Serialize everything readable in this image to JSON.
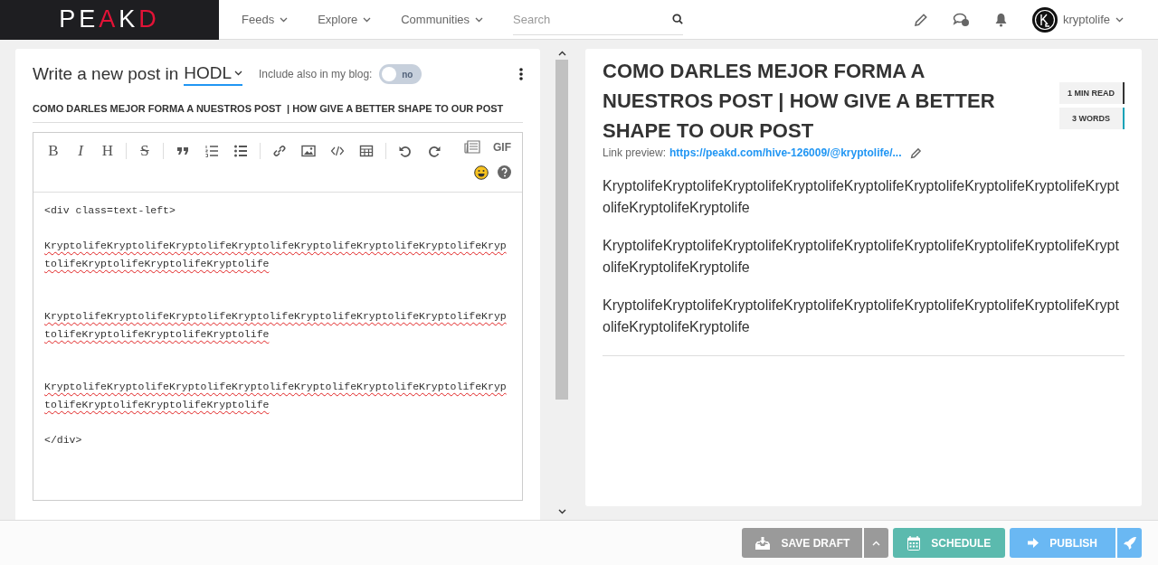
{
  "header": {
    "logo": {
      "letters": [
        {
          "text": "PE",
          "color": "#ffffff"
        },
        {
          "text": "A",
          "color": "#e31337"
        },
        {
          "text": "K",
          "color": "#ffffff"
        },
        {
          "text": "D",
          "color": "#e31337"
        }
      ]
    },
    "nav": [
      {
        "label": "Feeds"
      },
      {
        "label": "Explore"
      },
      {
        "label": "Communities"
      }
    ],
    "search": {
      "placeholder": "Search"
    },
    "user": {
      "name": "kryptolife"
    }
  },
  "editor": {
    "heading": "Write a new post in",
    "community": "HODL",
    "include_label": "Include also in my blog:",
    "include_toggle": {
      "on": false,
      "label": "no"
    },
    "title": "COMO DARLES MEJOR FORMA A NUESTROS POST  | HOW GIVE A BETTER SHAPE TO OUR POST",
    "toolbar": [
      {
        "kind": "bold",
        "label": "B"
      },
      {
        "kind": "italic",
        "label": "I"
      },
      {
        "kind": "heading",
        "label": "H"
      },
      {
        "kind": "sep"
      },
      {
        "kind": "strike",
        "label": "S"
      },
      {
        "kind": "sep"
      },
      {
        "kind": "quote"
      },
      {
        "kind": "ol"
      },
      {
        "kind": "ul"
      },
      {
        "kind": "sep"
      },
      {
        "kind": "link"
      },
      {
        "kind": "image"
      },
      {
        "kind": "code"
      },
      {
        "kind": "table"
      },
      {
        "kind": "sep"
      },
      {
        "kind": "undo"
      },
      {
        "kind": "redo"
      }
    ],
    "gif_label": "GIF",
    "lines": [
      {
        "text": "<div class=text-left>",
        "misspelled": false,
        "gap": false
      },
      {
        "text": "KryptolifeKryptolifeKryptolifeKryptolifeKryptolifeKryptolifeKryptolifeKryptolifeKryptolifeKryptolifeKryptolife",
        "misspelled": true,
        "gap": true
      },
      {
        "text": "KryptolifeKryptolifeKryptolifeKryptolifeKryptolifeKryptolifeKryptolifeKryptolifeKryptolifeKryptolifeKryptolife",
        "misspelled": true,
        "gap": true
      },
      {
        "text": "KryptolifeKryptolifeKryptolifeKryptolifeKryptolifeKryptolifeKryptolifeKryptolifeKryptolifeKryptolifeKryptolife",
        "misspelled": true,
        "gap": true
      },
      {
        "text": "</div>",
        "misspelled": false,
        "gap": false
      }
    ]
  },
  "preview": {
    "title": "COMO DARLES MEJOR FORMA A NUESTROS POST | HOW GIVE A BETTER SHAPE TO OUR POST",
    "badges": [
      {
        "text": "1 MIN READ",
        "color": "#333333"
      },
      {
        "text": "3 WORDS",
        "color": "#17a2b8"
      }
    ],
    "link_label": "Link preview:",
    "link": "https://peakd.com/hive-126009/@kryptolife/...",
    "paragraphs": [
      "KryptolifeKryptolifeKryptolifeKryptolifeKryptolifeKryptolifeKryptolifeKryptolifeKryptolifeKryptolifeKryptolife",
      "KryptolifeKryptolifeKryptolifeKryptolifeKryptolifeKryptolifeKryptolifeKryptolifeKryptolifeKryptolifeKryptolife",
      "KryptolifeKryptolifeKryptolifeKryptolifeKryptolifeKryptolifeKryptolifeKryptolifeKryptolifeKryptolifeKryptolife"
    ]
  },
  "footer": {
    "buttons": [
      {
        "kind": "draft",
        "label": "SAVE DRAFT"
      },
      {
        "kind": "schedule",
        "label": "SCHEDULE"
      },
      {
        "kind": "publish",
        "label": "PUBLISH"
      }
    ]
  }
}
